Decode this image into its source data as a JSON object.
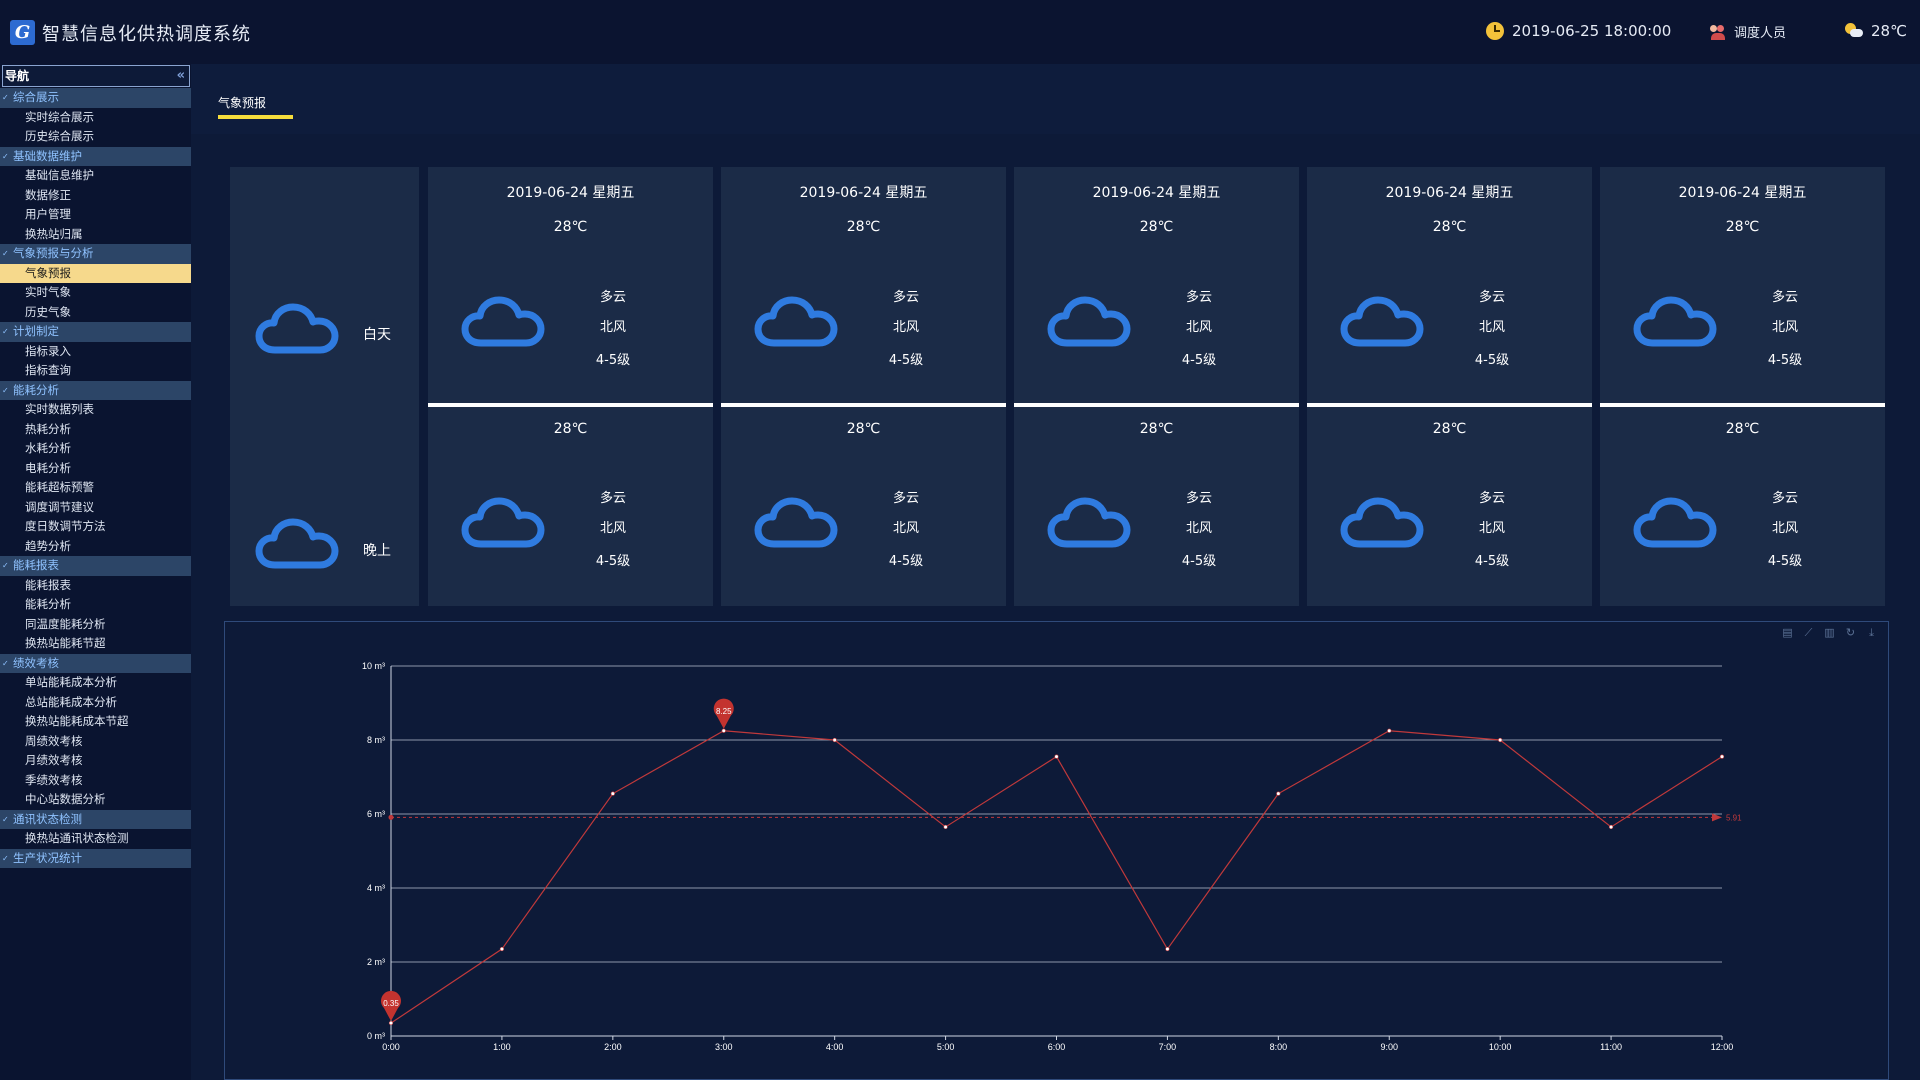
{
  "header": {
    "logo_letter": "G",
    "title": "智慧信息化供热调度系统",
    "datetime": "2019-06-25 18:00:00",
    "user": "调度人员",
    "temperature": "28℃"
  },
  "sidebar": {
    "title": "导航",
    "collapse_glyph": "«",
    "items": [
      {
        "label": "综合展示",
        "type": "group"
      },
      {
        "label": "实时综合展示",
        "type": "sub"
      },
      {
        "label": "历史综合展示",
        "type": "sub"
      },
      {
        "label": "基础数据维护",
        "type": "group"
      },
      {
        "label": "基础信息维护",
        "type": "sub"
      },
      {
        "label": "数据修正",
        "type": "sub"
      },
      {
        "label": "用户管理",
        "type": "sub"
      },
      {
        "label": "换热站归属",
        "type": "sub"
      },
      {
        "label": "气象预报与分析",
        "type": "group"
      },
      {
        "label": "气象预报",
        "type": "sub",
        "active": true
      },
      {
        "label": "实时气象",
        "type": "sub"
      },
      {
        "label": "历史气象",
        "type": "sub"
      },
      {
        "label": "计划制定",
        "type": "group"
      },
      {
        "label": "指标录入",
        "type": "sub"
      },
      {
        "label": "指标查询",
        "type": "sub"
      },
      {
        "label": "能耗分析",
        "type": "group"
      },
      {
        "label": "实时数据列表",
        "type": "sub"
      },
      {
        "label": "热耗分析",
        "type": "sub"
      },
      {
        "label": "水耗分析",
        "type": "sub"
      },
      {
        "label": "电耗分析",
        "type": "sub"
      },
      {
        "label": "能耗超标预警",
        "type": "sub"
      },
      {
        "label": "调度调节建议",
        "type": "sub"
      },
      {
        "label": "度日数调节方法",
        "type": "sub"
      },
      {
        "label": "趋势分析",
        "type": "sub"
      },
      {
        "label": "能耗报表",
        "type": "group"
      },
      {
        "label": "能耗报表",
        "type": "sub"
      },
      {
        "label": "能耗分析",
        "type": "sub"
      },
      {
        "label": "同温度能耗分析",
        "type": "sub"
      },
      {
        "label": "换热站能耗节超",
        "type": "sub"
      },
      {
        "label": "绩效考核",
        "type": "group"
      },
      {
        "label": "单站能耗成本分析",
        "type": "sub"
      },
      {
        "label": "总站能耗成本分析",
        "type": "sub"
      },
      {
        "label": "换热站能耗成本节超",
        "type": "sub"
      },
      {
        "label": "周绩效考核",
        "type": "sub"
      },
      {
        "label": "月绩效考核",
        "type": "sub"
      },
      {
        "label": "季绩效考核",
        "type": "sub"
      },
      {
        "label": "中心站数据分析",
        "type": "sub"
      },
      {
        "label": "通讯状态检测",
        "type": "group"
      },
      {
        "label": "换热站通讯状态检测",
        "type": "sub"
      },
      {
        "label": "生产状况统计",
        "type": "group"
      }
    ]
  },
  "tabs": [
    {
      "label": "气象预报",
      "active": true
    }
  ],
  "weather": {
    "day_label": "白天",
    "night_label": "晚上",
    "icon": "cloud-icon",
    "icon_color": "#2f7be0",
    "days": [
      {
        "date": "2019-06-24 星期五",
        "day": {
          "temp": "28℃",
          "cond": "多云",
          "wind_dir": "北风",
          "wind_level": "4-5级"
        },
        "night": {
          "temp": "28℃",
          "cond": "多云",
          "wind_dir": "北风",
          "wind_level": "4-5级"
        }
      },
      {
        "date": "2019-06-24 星期五",
        "day": {
          "temp": "28℃",
          "cond": "多云",
          "wind_dir": "北风",
          "wind_level": "4-5级"
        },
        "night": {
          "temp": "28℃",
          "cond": "多云",
          "wind_dir": "北风",
          "wind_level": "4-5级"
        }
      },
      {
        "date": "2019-06-24 星期五",
        "day": {
          "temp": "28℃",
          "cond": "多云",
          "wind_dir": "北风",
          "wind_level": "4-5级"
        },
        "night": {
          "temp": "28℃",
          "cond": "多云",
          "wind_dir": "北风",
          "wind_level": "4-5级"
        }
      },
      {
        "date": "2019-06-24 星期五",
        "day": {
          "temp": "28℃",
          "cond": "多云",
          "wind_dir": "北风",
          "wind_level": "4-5级"
        },
        "night": {
          "temp": "28℃",
          "cond": "多云",
          "wind_dir": "北风",
          "wind_level": "4-5级"
        }
      },
      {
        "date": "2019-06-24 星期五",
        "day": {
          "temp": "28℃",
          "cond": "多云",
          "wind_dir": "北风",
          "wind_level": "4-5级"
        },
        "night": {
          "temp": "28℃",
          "cond": "多云",
          "wind_dir": "北风",
          "wind_level": "4-5级"
        }
      }
    ]
  },
  "toolbox": [
    "data-view-icon",
    "line-chart-icon",
    "bar-chart-icon",
    "refresh-icon",
    "download-icon"
  ],
  "chart_data": {
    "type": "line",
    "x": [
      "0:00",
      "1:00",
      "2:00",
      "3:00",
      "4:00",
      "5:00",
      "6:00",
      "7:00",
      "8:00",
      "9:00",
      "10:00",
      "11:00",
      "12:00"
    ],
    "series": [
      {
        "values": [
          0.35,
          2.35,
          6.55,
          8.25,
          8.0,
          5.65,
          7.55,
          2.35,
          6.55,
          8.25,
          8.0,
          5.65,
          7.55
        ]
      }
    ],
    "yticks": [
      "0 m³",
      "2 m³",
      "4 m³",
      "6 m³",
      "8 m³",
      "10 m³"
    ],
    "ylim": [
      0,
      10
    ],
    "max_label": "8.25",
    "min_label": "0.35",
    "average_label": "5.91",
    "average_value": 5.91,
    "line_color": "#c0393b",
    "grid": true
  }
}
